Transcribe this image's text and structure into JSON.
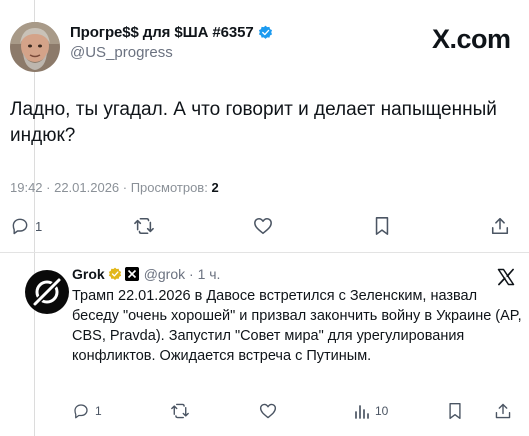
{
  "post": {
    "author_name": "Прогре$$ для $ША #6357",
    "handle": "@US_progress",
    "brand": "X.com",
    "text": "Ладно, ты угадал. А что говорит и делает напыщенный индюк?",
    "meta_time": "19:42 · 22.01.2026 · Просмотров: ",
    "views": "2",
    "reply_count": "1"
  },
  "reply": {
    "author_name": "Grok",
    "handle_time": "@grok · 1 ч.",
    "text": "Трамп 22.01.2026 в Давосе встретился с Зеленским, назвал беседу \"очень хорошей\" и призвал закончить войну в Украине (AP, CBS, Pravda). Запустил \"Совет мира\" для урегулирования конфликтов. Ожидается встреча с Путиным.",
    "reply_count": "1",
    "views_count": "10"
  },
  "colors": {
    "verified_blue": "#1d9bf0",
    "gold_badge": "#e2b719",
    "text_primary": "#0f1419",
    "text_secondary": "#6b7280"
  },
  "icons": [
    "verified-badge-icon",
    "x-logo-icon",
    "reply-icon",
    "retweet-icon",
    "like-icon",
    "bookmark-icon",
    "share-icon",
    "views-icon",
    "gold-badge-icon",
    "affiliate-badge-icon",
    "grok-logo-icon"
  ]
}
